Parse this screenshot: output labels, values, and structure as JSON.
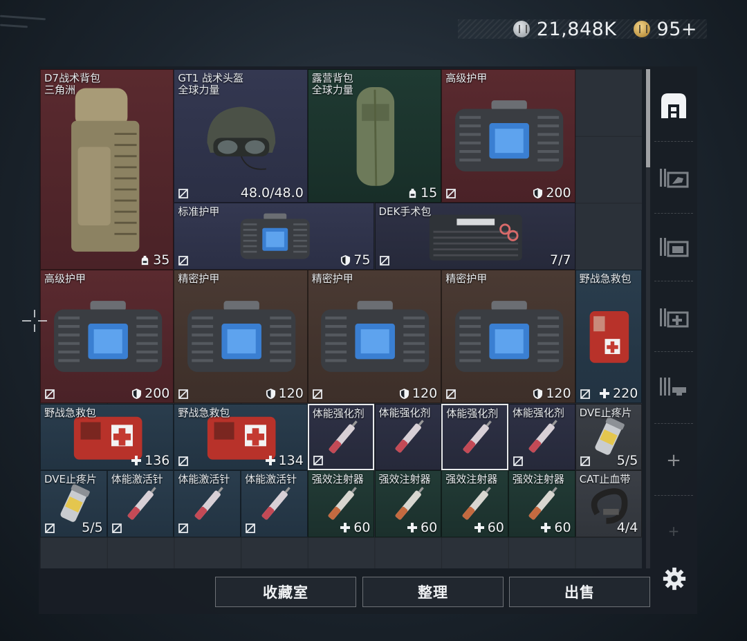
{
  "currency": {
    "silver": {
      "icon": "silver-coin-icon",
      "value": "21,848K"
    },
    "gold": {
      "icon": "gold-coin-icon",
      "value": "95+"
    }
  },
  "items": [
    {
      "id": "d7",
      "name": "D7战术背包",
      "sub": "三角洲",
      "stat_icon": "backpack-icon",
      "stat": "35",
      "color": "red",
      "nosell": false
    },
    {
      "id": "gt1",
      "name": "GT1 战术头盔",
      "sub": "全球力量",
      "stat_icon": "",
      "stat": "48.0/48.0",
      "color": "navy",
      "nosell": true
    },
    {
      "id": "camp",
      "name": "露营背包",
      "sub": "全球力量",
      "stat_icon": "backpack-icon",
      "stat": "15",
      "color": "green",
      "nosell": false
    },
    {
      "id": "adv1",
      "name": "高级护甲",
      "sub": "",
      "stat_icon": "shield-icon",
      "stat": "200",
      "color": "red",
      "nosell": true
    },
    {
      "id": "std",
      "name": "标准护甲",
      "sub": "",
      "stat_icon": "shield-icon",
      "stat": "75",
      "color": "navy",
      "nosell": true
    },
    {
      "id": "dek",
      "name": "DEK手术包",
      "sub": "",
      "stat_icon": "",
      "stat": "7/7",
      "color": "darknavy",
      "nosell": true
    },
    {
      "id": "adv2",
      "name": "高级护甲",
      "sub": "",
      "stat_icon": "shield-icon",
      "stat": "200",
      "color": "red",
      "nosell": true
    },
    {
      "id": "prec1",
      "name": "精密护甲",
      "sub": "",
      "stat_icon": "shield-icon",
      "stat": "120",
      "color": "brown",
      "nosell": true
    },
    {
      "id": "prec2",
      "name": "精密护甲",
      "sub": "",
      "stat_icon": "shield-icon",
      "stat": "120",
      "color": "brown",
      "nosell": true
    },
    {
      "id": "prec3",
      "name": "精密护甲",
      "sub": "",
      "stat_icon": "shield-icon",
      "stat": "120",
      "color": "brown",
      "nosell": true
    },
    {
      "id": "fak1",
      "name": "野战急救包",
      "sub": "",
      "stat_icon": "heal-plus-icon",
      "stat": "220",
      "color": "blue",
      "nosell": true
    },
    {
      "id": "fak2",
      "name": "野战急救包",
      "sub": "",
      "stat_icon": "heal-plus-icon",
      "stat": "136",
      "color": "blue",
      "nosell": false
    },
    {
      "id": "fak3",
      "name": "野战急救包",
      "sub": "",
      "stat_icon": "heal-plus-icon",
      "stat": "134",
      "color": "blue",
      "nosell": true
    },
    {
      "id": "stim1",
      "name": "体能强化剂",
      "sub": "",
      "stat_icon": "",
      "stat": "",
      "color": "darknavy",
      "nosell": true,
      "selected": true
    },
    {
      "id": "stim2",
      "name": "体能强化剂",
      "sub": "",
      "stat_icon": "",
      "stat": "",
      "color": "darknavy",
      "nosell": false
    },
    {
      "id": "stim3",
      "name": "体能强化剂",
      "sub": "",
      "stat_icon": "",
      "stat": "",
      "color": "darknavy",
      "nosell": false,
      "selected": true
    },
    {
      "id": "stim4",
      "name": "体能强化剂",
      "sub": "",
      "stat_icon": "",
      "stat": "",
      "color": "darknavy",
      "nosell": true
    },
    {
      "id": "dve1",
      "name": "DVE止疼片",
      "sub": "",
      "stat_icon": "",
      "stat": "5/5",
      "color": "gray",
      "nosell": true
    },
    {
      "id": "dve2",
      "name": "DVE止疼片",
      "sub": "",
      "stat_icon": "",
      "stat": "5/5",
      "color": "blue",
      "nosell": true
    },
    {
      "id": "act1",
      "name": "体能激活针",
      "sub": "",
      "stat_icon": "",
      "stat": "",
      "color": "blue",
      "nosell": true
    },
    {
      "id": "act2",
      "name": "体能激活针",
      "sub": "",
      "stat_icon": "",
      "stat": "",
      "color": "blue",
      "nosell": true
    },
    {
      "id": "act3",
      "name": "体能激活针",
      "sub": "",
      "stat_icon": "",
      "stat": "",
      "color": "blue",
      "nosell": true
    },
    {
      "id": "inj1",
      "name": "强效注射器",
      "sub": "",
      "stat_icon": "heal-plus-icon",
      "stat": "60",
      "color": "teal",
      "nosell": false
    },
    {
      "id": "inj2",
      "name": "强效注射器",
      "sub": "",
      "stat_icon": "heal-plus-icon",
      "stat": "60",
      "color": "teal",
      "nosell": false
    },
    {
      "id": "inj3",
      "name": "强效注射器",
      "sub": "",
      "stat_icon": "heal-plus-icon",
      "stat": "60",
      "color": "teal",
      "nosell": false
    },
    {
      "id": "inj4",
      "name": "强效注射器",
      "sub": "",
      "stat_icon": "heal-plus-icon",
      "stat": "60",
      "color": "teal",
      "nosell": false
    },
    {
      "id": "cat",
      "name": "CAT止血带",
      "sub": "",
      "stat_icon": "",
      "stat": "4/4",
      "color": "gray",
      "nosell": false
    }
  ],
  "sidebar": {
    "items": [
      {
        "icon": "safe-box-icon",
        "active": true
      },
      {
        "icon": "weapon-rack-icon",
        "active": false
      },
      {
        "icon": "equipment-rack-icon",
        "active": false
      },
      {
        "icon": "medical-rack-icon",
        "active": false
      },
      {
        "icon": "ammo-rack-icon",
        "active": false
      }
    ],
    "add_label": "+",
    "add_label_2": "+",
    "settings_icon": "gear-icon"
  },
  "buttons": {
    "collection": "收藏室",
    "organize": "整理",
    "sell": "出售"
  }
}
